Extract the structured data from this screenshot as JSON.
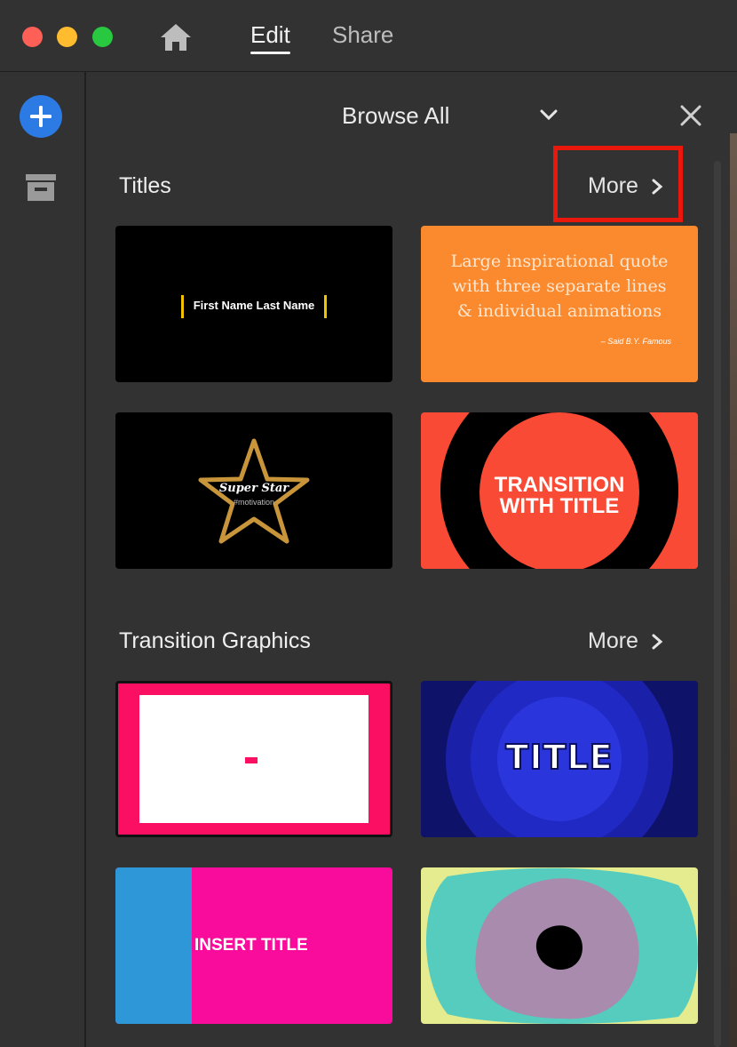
{
  "window": {
    "tabs": [
      {
        "label": "Edit",
        "active": true
      },
      {
        "label": "Share",
        "active": false
      }
    ]
  },
  "panel": {
    "header": {
      "title": "Browse All"
    },
    "sections": [
      {
        "title": "Titles",
        "more_label": "More",
        "items": [
          {
            "name": "lower-third",
            "text": "First Name Last Name"
          },
          {
            "name": "quote",
            "lines": [
              "Large inspirational quote",
              "with three separate lines",
              "& individual animations"
            ],
            "attribution": "– Said B.Y. Famous"
          },
          {
            "name": "super-star",
            "title": "Super Star",
            "subtitle": "#motivation"
          },
          {
            "name": "transition-with-title",
            "lines": [
              "TRANSITION",
              "WITH TITLE"
            ]
          }
        ]
      },
      {
        "title": "Transition Graphics",
        "more_label": "More",
        "items": [
          {
            "name": "pink-frame",
            "text": ""
          },
          {
            "name": "blue-title",
            "text": "TITLE"
          },
          {
            "name": "insert-title",
            "text": "INSERT TITLE"
          },
          {
            "name": "blob",
            "text": ""
          }
        ]
      }
    ]
  },
  "colors": {
    "accent_blue": "#2c7be5",
    "highlight_red": "#e8180c",
    "panel_bg": "#323232"
  },
  "icons": [
    "home-icon",
    "add-icon",
    "archive-icon",
    "chevron-down-icon",
    "close-icon",
    "chevron-right-icon"
  ]
}
